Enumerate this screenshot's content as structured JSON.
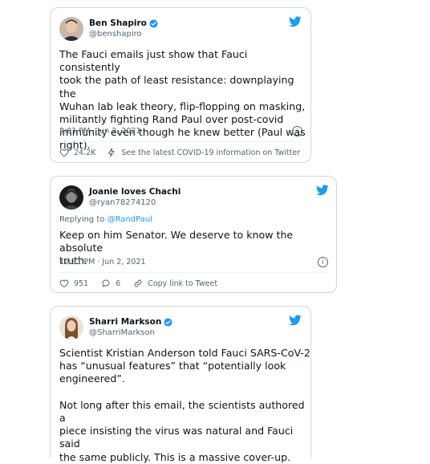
{
  "colors": {
    "accent": "#1d9bf0",
    "text": "#0f1419",
    "muted": "#536471",
    "border": "#cfd9de"
  },
  "tweets": [
    {
      "name": "Ben Shapiro",
      "handle": "@benshapiro",
      "verified": true,
      "text": "The Fauci emails just show that Fauci consistently\ntook the path of least resistance: downplaying the\nWuhan lab leak theory, flip-flopping on masking,\nmilitantly fighting Rand Paul over post-covid\nimmunity even though he knew better (Paul was\nright).",
      "timestamp": "2:01 PM · Jun 2, 2021",
      "likes": "24.2K",
      "extra_action": "See the latest COVID-19 information on Twitter"
    },
    {
      "name": "Joanie loves Chachi",
      "handle": "@ryan78274120",
      "verified": false,
      "reply_prefix": "Replying to",
      "reply_to": "@RandPaul",
      "text": "Keep on him Senator. We deserve to know the absolute\ntruth.",
      "timestamp": "12:31 PM · Jun 2, 2021",
      "likes": "951",
      "replies": "6",
      "extra_action": "Copy link to Tweet"
    },
    {
      "name": "Sharri Markson",
      "handle": "@SharriMarkson",
      "verified": true,
      "text": "Scientist Kristian Anderson told Fauci SARS-CoV-2\nhas “unusual features” that “potentially look\nengineered”.\n\nNot long after this email, the scientists authored a\npiece insisting the virus was natural and Fauci said\nthe same publicly. This is a massive cover-up."
    }
  ],
  "icons": [
    "verified-badge-icon",
    "twitter-bird-icon",
    "info-icon",
    "heart-icon",
    "bolt-icon",
    "reply-icon",
    "link-icon"
  ]
}
